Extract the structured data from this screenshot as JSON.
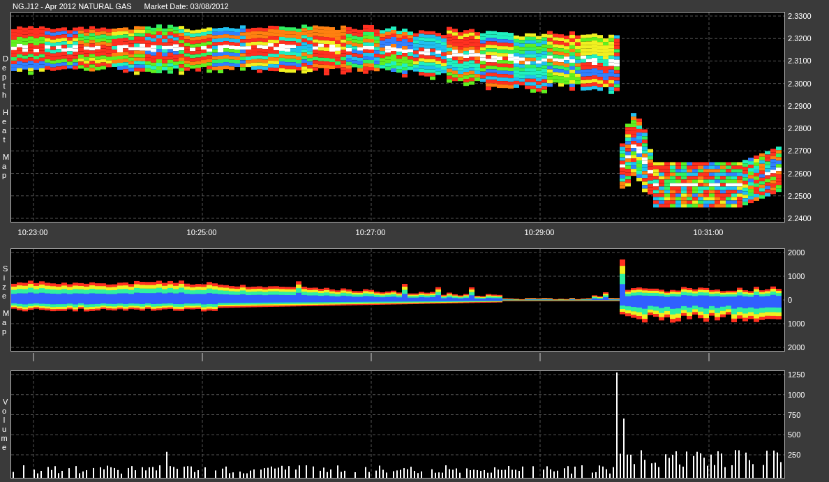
{
  "header": {
    "title": "NG.J12 - Apr 2012 NATURAL GAS",
    "market_date": "Market Date: 03/08/2012"
  },
  "panels": [
    {
      "kind": "depth",
      "label": [
        "Depth",
        "Heat",
        "Map"
      ],
      "y_ticks": [
        "2.3300",
        "2.3200",
        "2.3100",
        "2.3000",
        "2.2900",
        "2.2800",
        "2.2700",
        "2.2600",
        "2.2500",
        "2.2400"
      ]
    },
    {
      "kind": "size",
      "label": [
        "Size",
        "Map"
      ],
      "y_ticks": [
        "2000",
        "1000",
        "0",
        "1000",
        "2000"
      ]
    },
    {
      "kind": "volume",
      "label": [
        "Volume"
      ],
      "y_ticks": [
        "1250",
        "1000",
        "750",
        "500",
        "250"
      ]
    }
  ],
  "time_axis": {
    "ticks": [
      "10:23:00",
      "10:25:00",
      "10:27:00",
      "10:29:00",
      "10:31:00"
    ]
  }
}
